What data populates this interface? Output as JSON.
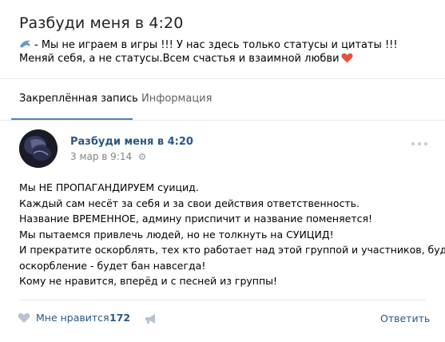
{
  "group": {
    "title": "Разбуди меня в 4:20",
    "status_text": "- Мы не играем в игры !!! У нас здесь только статусы и цитаты !!! Меняй себя, а не статусы.Всем счастья и взаимной любви"
  },
  "tabs": [
    {
      "label": "Закреплённая запись"
    },
    {
      "label": "Информация"
    }
  ],
  "post": {
    "author": "Разбуди меня в 4:20",
    "date": "3 мар в 9:14",
    "lines": [
      "Мы НЕ ПРОПАГАНДИРУЕМ суицид.",
      "Каждый сам несёт за себя и за свои действия ответственность.",
      "Название ВРЕМЕННОЕ, админу приспичит и название поменяется!",
      "Мы пытаемся привлечь людей, но не толкнуть на СУИЦИД!",
      "И прекратите оскорблять, тех кто работает над этой группой и участников, будут",
      "оскорбление - будет бан навсегда!",
      "Кому не нравится, вперёд и с песней из группы!"
    ],
    "like_label": "Мне нравится",
    "like_count": "172",
    "reply_label": "Ответить"
  },
  "colors": {
    "link": "#2a5885",
    "accent": "#5181b8",
    "background": "#edeef0",
    "muted": "#828282"
  },
  "icons": [
    "dolphin-icon",
    "heart-emoji-icon",
    "gear-icon",
    "more-dots-icon",
    "like-heart-icon",
    "share-megaphone-icon"
  ]
}
